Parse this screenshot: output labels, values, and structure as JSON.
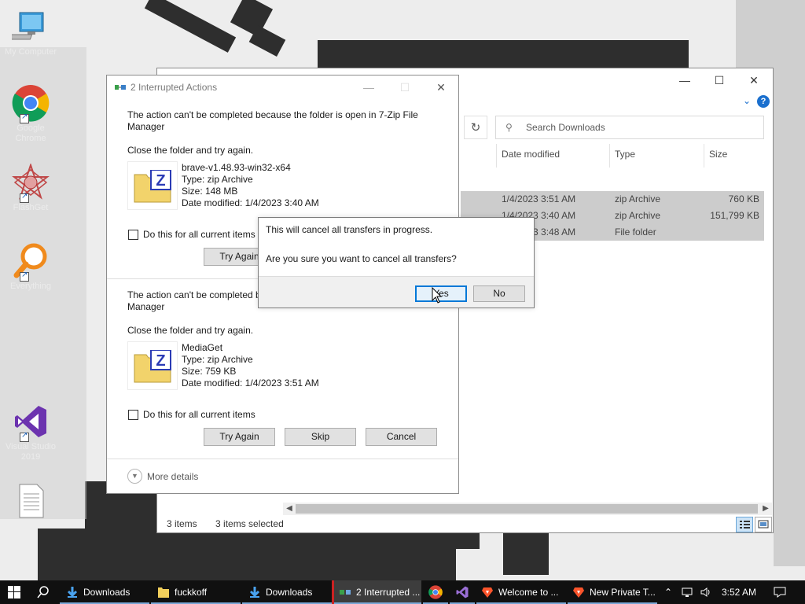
{
  "desktop": {
    "icons": [
      {
        "label": "My Computer",
        "icon": "computer-icon"
      },
      {
        "label": "Google Chrome",
        "icon": "chrome-icon"
      },
      {
        "label": "FlashGet",
        "icon": "star-app-icon"
      },
      {
        "label": "Everything",
        "icon": "search-app-icon"
      },
      {
        "label": "Visual Studio 2019",
        "icon": "visual-studio-icon"
      },
      {
        "label": "",
        "icon": "text-file-icon"
      }
    ]
  },
  "explorer": {
    "search_placeholder": "Search Downloads",
    "columns": [
      "Date modified",
      "Type",
      "Size"
    ],
    "rows": [
      {
        "date": "1/4/2023 3:51 AM",
        "type": "zip Archive",
        "size": "760 KB"
      },
      {
        "date": "1/4/2023 3:40 AM",
        "type": "zip Archive",
        "size": "151,799 KB"
      },
      {
        "date": "1/4/2023 3:48 AM",
        "type": "File folder",
        "size": ""
      }
    ],
    "status_items": "3 items",
    "status_selected": "3 items selected"
  },
  "interrupted": {
    "title": "2 Interrupted Actions",
    "block1": {
      "message_line1": "The action can't be completed because the folder is open in 7-Zip File",
      "message_line2": "Manager",
      "hint": "Close the folder and try again.",
      "file_name": "brave-v1.48.93-win32-x64",
      "file_type": "Type: zip Archive",
      "file_size": "Size: 148 MB",
      "file_date": "Date modified: 1/4/2023 3:40 AM",
      "checkbox_label": "Do this for all current items",
      "try_again": "Try Again"
    },
    "block2": {
      "message_line1": "The action can't be completed b",
      "message_line2": "Manager",
      "hint": "Close the folder and try again.",
      "file_name": "MediaGet",
      "file_type": "Type: zip Archive",
      "file_size": "Size: 759 KB",
      "file_date": "Date modified: 1/4/2023 3:51 AM",
      "checkbox_label": "Do this for all current items",
      "try_again": "Try Again",
      "skip": "Skip",
      "cancel": "Cancel"
    },
    "more_details": "More details"
  },
  "confirm": {
    "line1": "This will cancel all transfers in progress.",
    "line2": "Are you sure you want to cancel all transfers?",
    "yes": "Yes",
    "no": "No"
  },
  "taskbar": {
    "items": [
      {
        "label": "Downloads",
        "icon": "download-folder-icon"
      },
      {
        "label": "fuckkoff",
        "icon": "folder-icon"
      },
      {
        "label": "Downloads",
        "icon": "download-folder-icon"
      },
      {
        "label": "2 Interrupted ...",
        "icon": "transfer-icon"
      },
      {
        "label": "Welcome to ...",
        "icon": "brave-icon"
      },
      {
        "label": "New Private T...",
        "icon": "brave-icon"
      }
    ],
    "clock": "3:52 AM"
  },
  "colors": {
    "accent": "#0078d7",
    "taskbar": "#101010",
    "selection": "#cccccc"
  }
}
